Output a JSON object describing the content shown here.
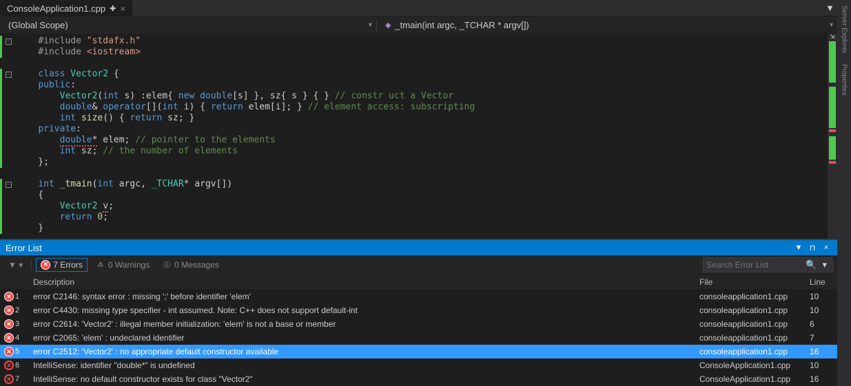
{
  "tab": {
    "filename": "ConsoleApplication1.cpp",
    "close": "×",
    "dirty": "✚"
  },
  "nav": {
    "scope": "(Global Scope)",
    "func": "_tmain(int argc, _TCHAR * argv[])"
  },
  "code": {
    "lines": [
      {
        "outline": "-",
        "bar": true,
        "html": "<span class='inc'>#include</span> <span class='str'>\"stdafx.h\"</span>"
      },
      {
        "bar": true,
        "html": "<span class='inc'>#include</span> <span class='str'>&lt;iostream&gt;</span>"
      },
      {
        "html": ""
      },
      {
        "outline": "-",
        "bar": true,
        "html": "<span class='kw'>class</span> <span class='type'>Vector2</span> {"
      },
      {
        "bar": true,
        "html": "<span class='kw'>public</span>:"
      },
      {
        "bar": true,
        "html": "    <span class='type'>Vector2</span>(<span class='kw'>int</span> s) :elem{ <span class='kw'>new</span> <span class='kw'>double</span>[s] }, sz{ s } { } <span class='cmt'>// constr uct a Vector</span>"
      },
      {
        "bar": true,
        "html": "    <span class='kw'>double</span>&amp; <span class='kw'>operator</span>[](<span class='kw'>int</span> i) { <span class='kw'>return</span> elem[i]; } <span class='cmt'>// element access: subscripting</span>"
      },
      {
        "bar": true,
        "html": "    <span class='kw'>int</span> <span class='fn'>size</span>() { <span class='kw'>return</span> sz; }"
      },
      {
        "bar": true,
        "html": "<span class='kw'>private</span>:"
      },
      {
        "bar": true,
        "html": "    <span class='squig'><span class='kw'>double</span>*</span> elem; <span class='cmt'>// pointer to the elements</span>"
      },
      {
        "bar": true,
        "html": "    <span class='kw'>int</span> sz; <span class='cmt'>// the number of elements</span>"
      },
      {
        "bar": true,
        "html": "};"
      },
      {
        "html": ""
      },
      {
        "outline": "-",
        "bar": true,
        "html": "<span class='kw'>int</span> <span class='fn'>_tmain</span>(<span class='kw'>int</span> argc, <span class='type'>_TCHAR</span>* argv[])"
      },
      {
        "bar": true,
        "html": "{"
      },
      {
        "bar": true,
        "html": "    <span class='type'>Vector2</span> <span class='squig'>v</span>;"
      },
      {
        "bar": true,
        "html": "    <span class='kw'>return</span> <span class='num'>0</span>;"
      },
      {
        "bar": true,
        "html": "}"
      }
    ]
  },
  "errorlist": {
    "title": "Error List",
    "filters": {
      "errors": "7 Errors",
      "warnings": "0 Warnings",
      "messages": "0 Messages"
    },
    "search_placeholder": "Search Error List",
    "headers": {
      "desc": "Description",
      "file": "File",
      "line": "Line"
    },
    "rows": [
      {
        "kind": "err",
        "n": "1",
        "desc": "error C2146: syntax error : missing ';' before identifier 'elem'",
        "file": "consoleapplication1.cpp",
        "line": "10"
      },
      {
        "kind": "err",
        "n": "2",
        "desc": "error C4430: missing type specifier - int assumed. Note: C++ does not support default-int",
        "file": "consoleapplication1.cpp",
        "line": "10"
      },
      {
        "kind": "err",
        "n": "3",
        "desc": "error C2614: 'Vector2' : illegal member initialization: 'elem' is not a base or member",
        "file": "consoleapplication1.cpp",
        "line": "6"
      },
      {
        "kind": "err",
        "n": "4",
        "desc": "error C2065: 'elem' : undeclared identifier",
        "file": "consoleapplication1.cpp",
        "line": "7"
      },
      {
        "kind": "err",
        "n": "5",
        "desc": "error C2512: 'Vector2' : no appropriate default constructor available",
        "file": "consoleapplication1.cpp",
        "line": "16",
        "sel": true
      },
      {
        "kind": "intelli",
        "n": "6",
        "desc": "IntelliSense: identifier \"double*\" is undefined",
        "file": "ConsoleApplication1.cpp",
        "line": "10"
      },
      {
        "kind": "intelli",
        "n": "7",
        "desc": "IntelliSense: no default constructor exists for class \"Vector2\"",
        "file": "ConsoleApplication1.cpp",
        "line": "16"
      }
    ]
  },
  "sidebar": {
    "server": "Server Explorer",
    "props": "Properties"
  }
}
